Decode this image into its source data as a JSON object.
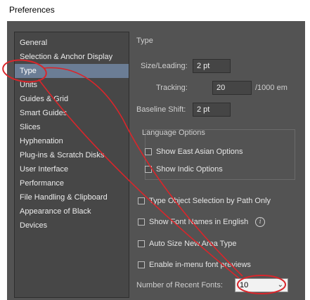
{
  "window": {
    "title": "Preferences"
  },
  "sidebar": {
    "items": [
      {
        "label": "General"
      },
      {
        "label": "Selection & Anchor Display"
      },
      {
        "label": "Type",
        "selected": true
      },
      {
        "label": "Units"
      },
      {
        "label": "Guides & Grid"
      },
      {
        "label": "Smart Guides"
      },
      {
        "label": "Slices"
      },
      {
        "label": "Hyphenation"
      },
      {
        "label": "Plug-ins & Scratch Disks"
      },
      {
        "label": "User Interface"
      },
      {
        "label": "Performance"
      },
      {
        "label": "File Handling & Clipboard"
      },
      {
        "label": "Appearance of Black"
      },
      {
        "label": "Devices"
      }
    ]
  },
  "type_panel": {
    "section_title": "Type",
    "size_leading": {
      "label": "Size/Leading:",
      "value": "2 pt"
    },
    "tracking": {
      "label": "Tracking:",
      "value": "20",
      "unit": "/1000 em"
    },
    "baseline_shift": {
      "label": "Baseline Shift:",
      "value": "2 pt"
    },
    "language_options": {
      "title": "Language Options",
      "show_east_asian": {
        "label": "Show East Asian Options",
        "checked": false
      },
      "show_indic": {
        "label": "Show Indic Options",
        "checked": false
      }
    },
    "type_object_selection": {
      "label": "Type Object Selection by Path Only",
      "checked": false
    },
    "show_font_names_english": {
      "label": "Show Font Names in English",
      "checked": false
    },
    "auto_size_new_area": {
      "label": "Auto Size New Area Type",
      "checked": false
    },
    "enable_inmenu_previews": {
      "label": "Enable in-menu font previews",
      "checked": false
    },
    "recent_fonts": {
      "label": "Number of Recent Fonts:",
      "value": "10"
    }
  },
  "colors": {
    "dialog_bg": "#535353",
    "selection": "#6b7d95",
    "annotation": "#d9262b"
  }
}
